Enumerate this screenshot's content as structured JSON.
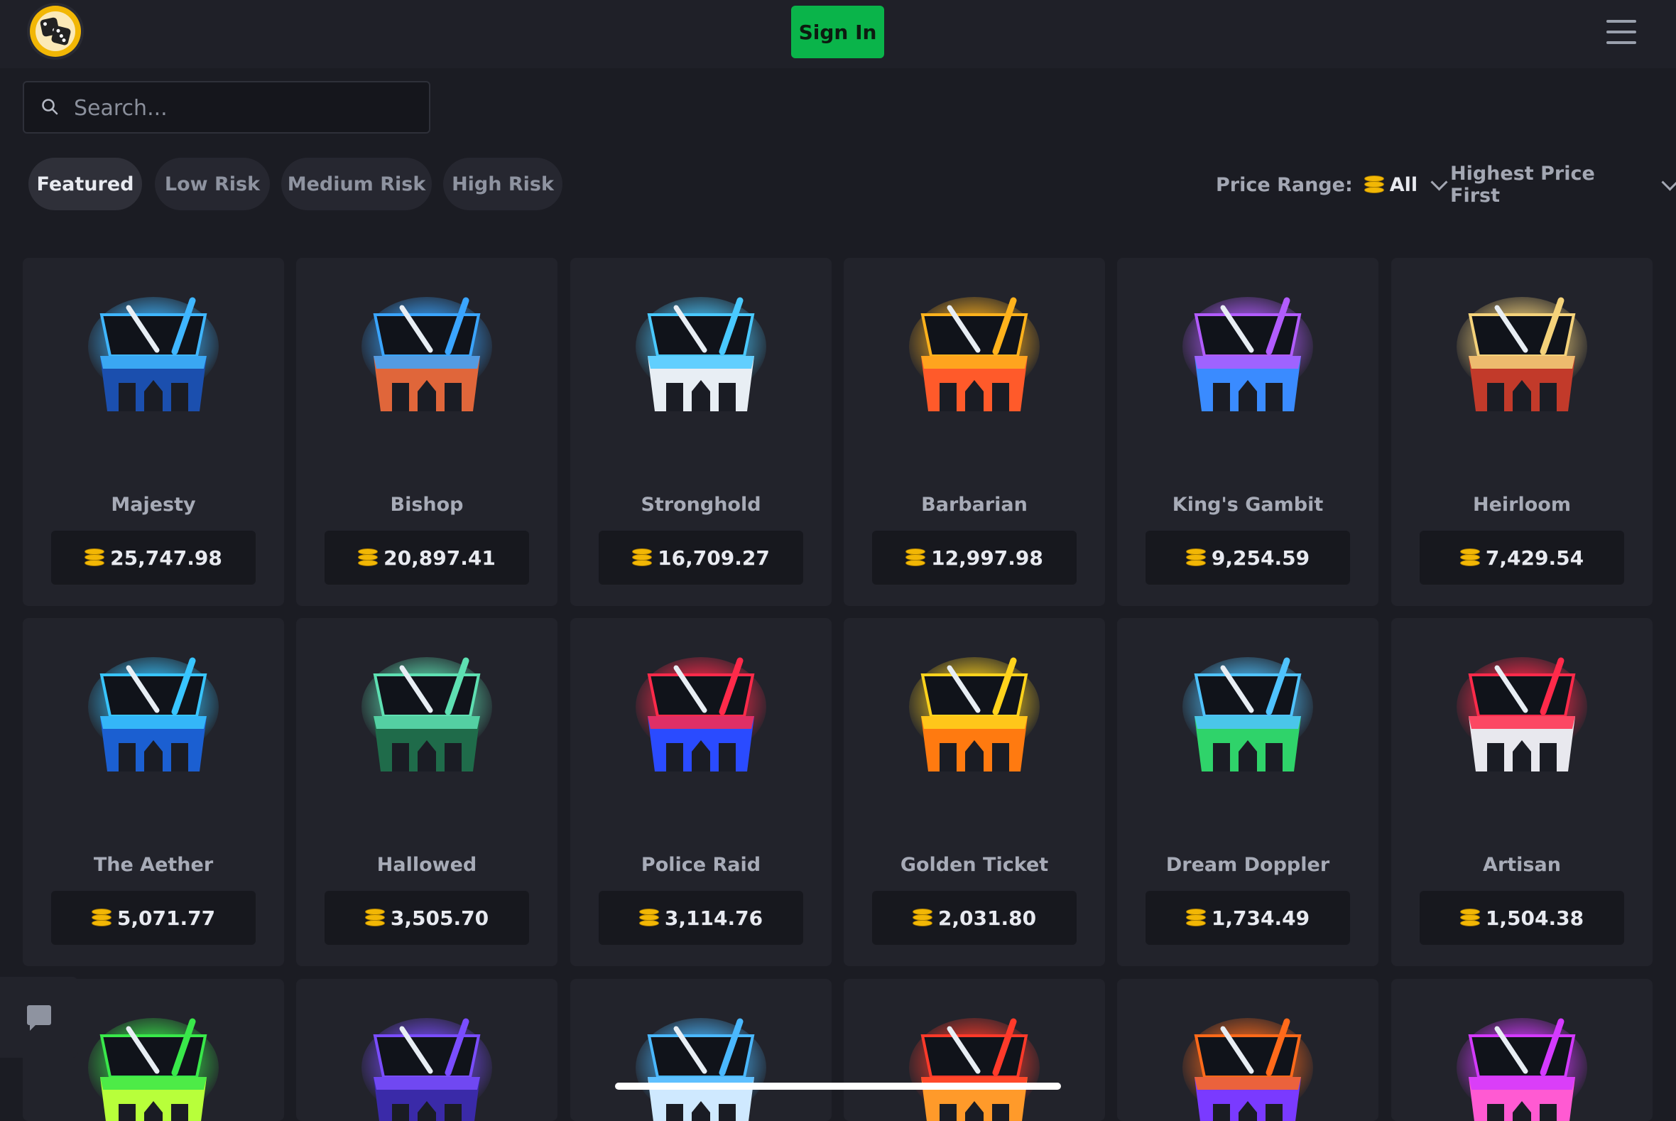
{
  "header": {
    "signin_label": "Sign In"
  },
  "search": {
    "placeholder": "Search..."
  },
  "tabs": [
    "Featured",
    "Low Risk",
    "Medium Risk",
    "High Risk"
  ],
  "filters": {
    "price_range_label": "Price Range:",
    "price_range_value": "All",
    "sort_value": "Highest Price First"
  },
  "cases": [
    {
      "name": "Majesty",
      "price": "25,747.98",
      "colors": [
        "#3fb6ff",
        "#1b4fae"
      ]
    },
    {
      "name": "Bishop",
      "price": "20,897.41",
      "colors": [
        "#3aa5ff",
        "#e0663a"
      ]
    },
    {
      "name": "Stronghold",
      "price": "16,709.27",
      "colors": [
        "#49c9ff",
        "#e8eef4"
      ]
    },
    {
      "name": "Barbarian",
      "price": "12,997.98",
      "colors": [
        "#ffb21c",
        "#ff5a2a"
      ]
    },
    {
      "name": "King's Gambit",
      "price": "9,254.59",
      "colors": [
        "#b25cff",
        "#3a8bff"
      ]
    },
    {
      "name": "Heirloom",
      "price": "7,429.54",
      "colors": [
        "#f4d27a",
        "#c23a2a"
      ]
    },
    {
      "name": "The Aether",
      "price": "5,071.77",
      "colors": [
        "#38c5ff",
        "#1b5fd1"
      ]
    },
    {
      "name": "Hallowed",
      "price": "3,505.70",
      "colors": [
        "#5ee0b2",
        "#1f6b4a"
      ]
    },
    {
      "name": "Police Raid",
      "price": "3,114.76",
      "colors": [
        "#ff2a4a",
        "#2a4bff"
      ]
    },
    {
      "name": "Golden Ticket",
      "price": "2,031.80",
      "colors": [
        "#ffd31c",
        "#ff7a10"
      ]
    },
    {
      "name": "Dream Doppler",
      "price": "1,734.49",
      "colors": [
        "#4fc3ff",
        "#2fd36a"
      ]
    },
    {
      "name": "Artisan",
      "price": "1,504.38",
      "colors": [
        "#ff2a4a",
        "#e8e8ee"
      ]
    }
  ],
  "partial_cases": [
    {
      "colors": [
        "#39e84a",
        "#b8ff3a"
      ]
    },
    {
      "colors": [
        "#7a4dff",
        "#3a2aa8"
      ]
    },
    {
      "colors": [
        "#4ab8ff",
        "#cfe9ff"
      ]
    },
    {
      "colors": [
        "#ff3a2a",
        "#ff9a2a"
      ]
    },
    {
      "colors": [
        "#ff6a1a",
        "#7a3aff"
      ]
    },
    {
      "colors": [
        "#d43aff",
        "#ff5ad2"
      ]
    }
  ]
}
